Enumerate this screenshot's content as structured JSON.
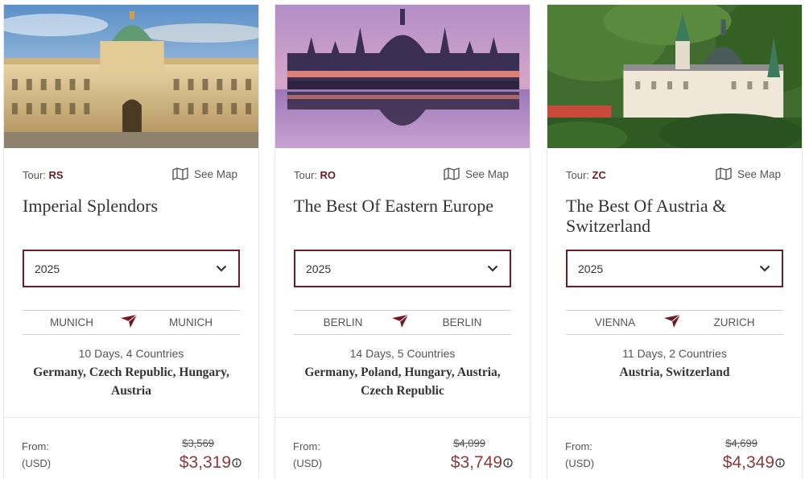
{
  "tours": [
    {
      "tour_label": "Tour:",
      "tour_code": "RS",
      "see_map": "See Map",
      "title": "Imperial Splendors",
      "year": "2025",
      "route_from": "MUNICH",
      "route_to": "MUNICH",
      "days_countries": "10 Days, 4 Countries",
      "countries": "Germany, Czech Republic, Hungary, Austria",
      "from_label": "From:",
      "currency": "(USD)",
      "old_price": "$3,569",
      "price": "$3,319"
    },
    {
      "tour_label": "Tour:",
      "tour_code": "RO",
      "see_map": "See Map",
      "title": "The Best Of Eastern Europe",
      "year": "2025",
      "route_from": "BERLIN",
      "route_to": "BERLIN",
      "days_countries": "14 Days, 5 Countries",
      "countries": "Germany, Poland, Hungary, Austria, Czech Republic",
      "from_label": "From:",
      "currency": "(USD)",
      "old_price": "$4,099",
      "price": "$3,749"
    },
    {
      "tour_label": "Tour:",
      "tour_code": "ZC",
      "see_map": "See Map",
      "title": "The Best Of Austria & Switzerland",
      "year": "2025",
      "route_from": "VIENNA",
      "route_to": "ZURICH",
      "days_countries": "11 Days, 2 Countries",
      "countries": "Austria, Switzerland",
      "from_label": "From:",
      "currency": "(USD)",
      "old_price": "$4,699",
      "price": "$4,349"
    }
  ],
  "icons": {
    "map": "map-icon",
    "chevron": "chevron-down-icon",
    "plane": "plane-icon",
    "info": "info-icon"
  },
  "colors": {
    "accent": "#6b1c24",
    "price": "#8a3a3e",
    "border": "#e6e6e6"
  }
}
